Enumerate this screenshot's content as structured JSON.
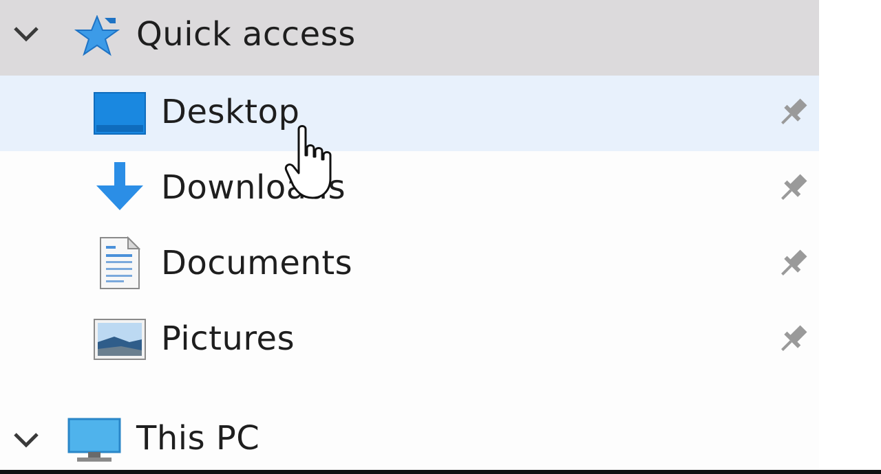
{
  "nav": {
    "quick_access": {
      "label": "Quick access",
      "icon": "star-icon",
      "expanded": true
    },
    "items": [
      {
        "label": "Desktop",
        "icon": "desktop-folder-icon",
        "pinned": true,
        "selected": true
      },
      {
        "label": "Downloads",
        "icon": "download-arrow-icon",
        "pinned": true
      },
      {
        "label": "Documents",
        "icon": "document-icon",
        "pinned": true
      },
      {
        "label": "Pictures",
        "icon": "pictures-icon",
        "pinned": true
      }
    ],
    "this_pc": {
      "label": "This PC",
      "icon": "monitor-icon",
      "expanded": true
    }
  },
  "colors": {
    "header_bg": "#dcdadc",
    "selected_bg": "#e8f1fc",
    "accent_blue": "#1a88e0",
    "text": "#1e1e1e",
    "pin": "#9a9a9a"
  }
}
